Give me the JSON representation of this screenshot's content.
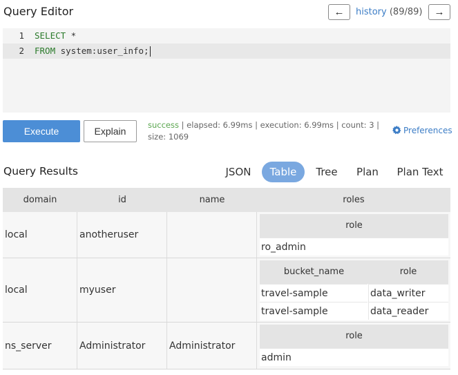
{
  "header": {
    "title": "Query Editor",
    "history_prev": "←",
    "history_next": "→",
    "history_label": "history",
    "history_count": "(89/89)"
  },
  "editor": {
    "lines": [
      {
        "number": "1",
        "keyword": "SELECT",
        "rest": " *"
      },
      {
        "number": "2",
        "keyword": "FROM",
        "rest": " system:user_info;"
      }
    ]
  },
  "actions": {
    "execute_label": "Execute",
    "explain_label": "Explain"
  },
  "status": {
    "state": "success",
    "details": " | elapsed: 6.99ms | execution: 6.99ms | count: 3 | size: 1069"
  },
  "preferences_label": "Preferences",
  "results": {
    "title": "Query Results",
    "tabs": [
      "JSON",
      "Table",
      "Tree",
      "Plan",
      "Plan Text"
    ],
    "active_tab": "Table",
    "columns": [
      "domain",
      "id",
      "name",
      "roles"
    ],
    "rows": [
      {
        "domain": "local",
        "id": "anotheruser",
        "name": "",
        "roles": {
          "columns": [
            "role"
          ],
          "rows": [
            [
              "ro_admin"
            ]
          ]
        }
      },
      {
        "domain": "local",
        "id": "myuser",
        "name": "",
        "roles": {
          "columns": [
            "bucket_name",
            "role"
          ],
          "rows": [
            [
              "travel-sample",
              "data_writer"
            ],
            [
              "travel-sample",
              "data_reader"
            ]
          ]
        }
      },
      {
        "domain": "ns_server",
        "id": "Administrator",
        "name": "Administrator",
        "roles": {
          "columns": [
            "role"
          ],
          "rows": [
            [
              "admin"
            ]
          ]
        }
      }
    ]
  },
  "colors": {
    "accent": "#4c8ed6",
    "tab_active": "#7aa8e0",
    "link": "#3c7dc6",
    "success": "#5aa64f",
    "keyword": "#2a7a2a"
  },
  "icons": {
    "preferences": "gear-icon"
  }
}
